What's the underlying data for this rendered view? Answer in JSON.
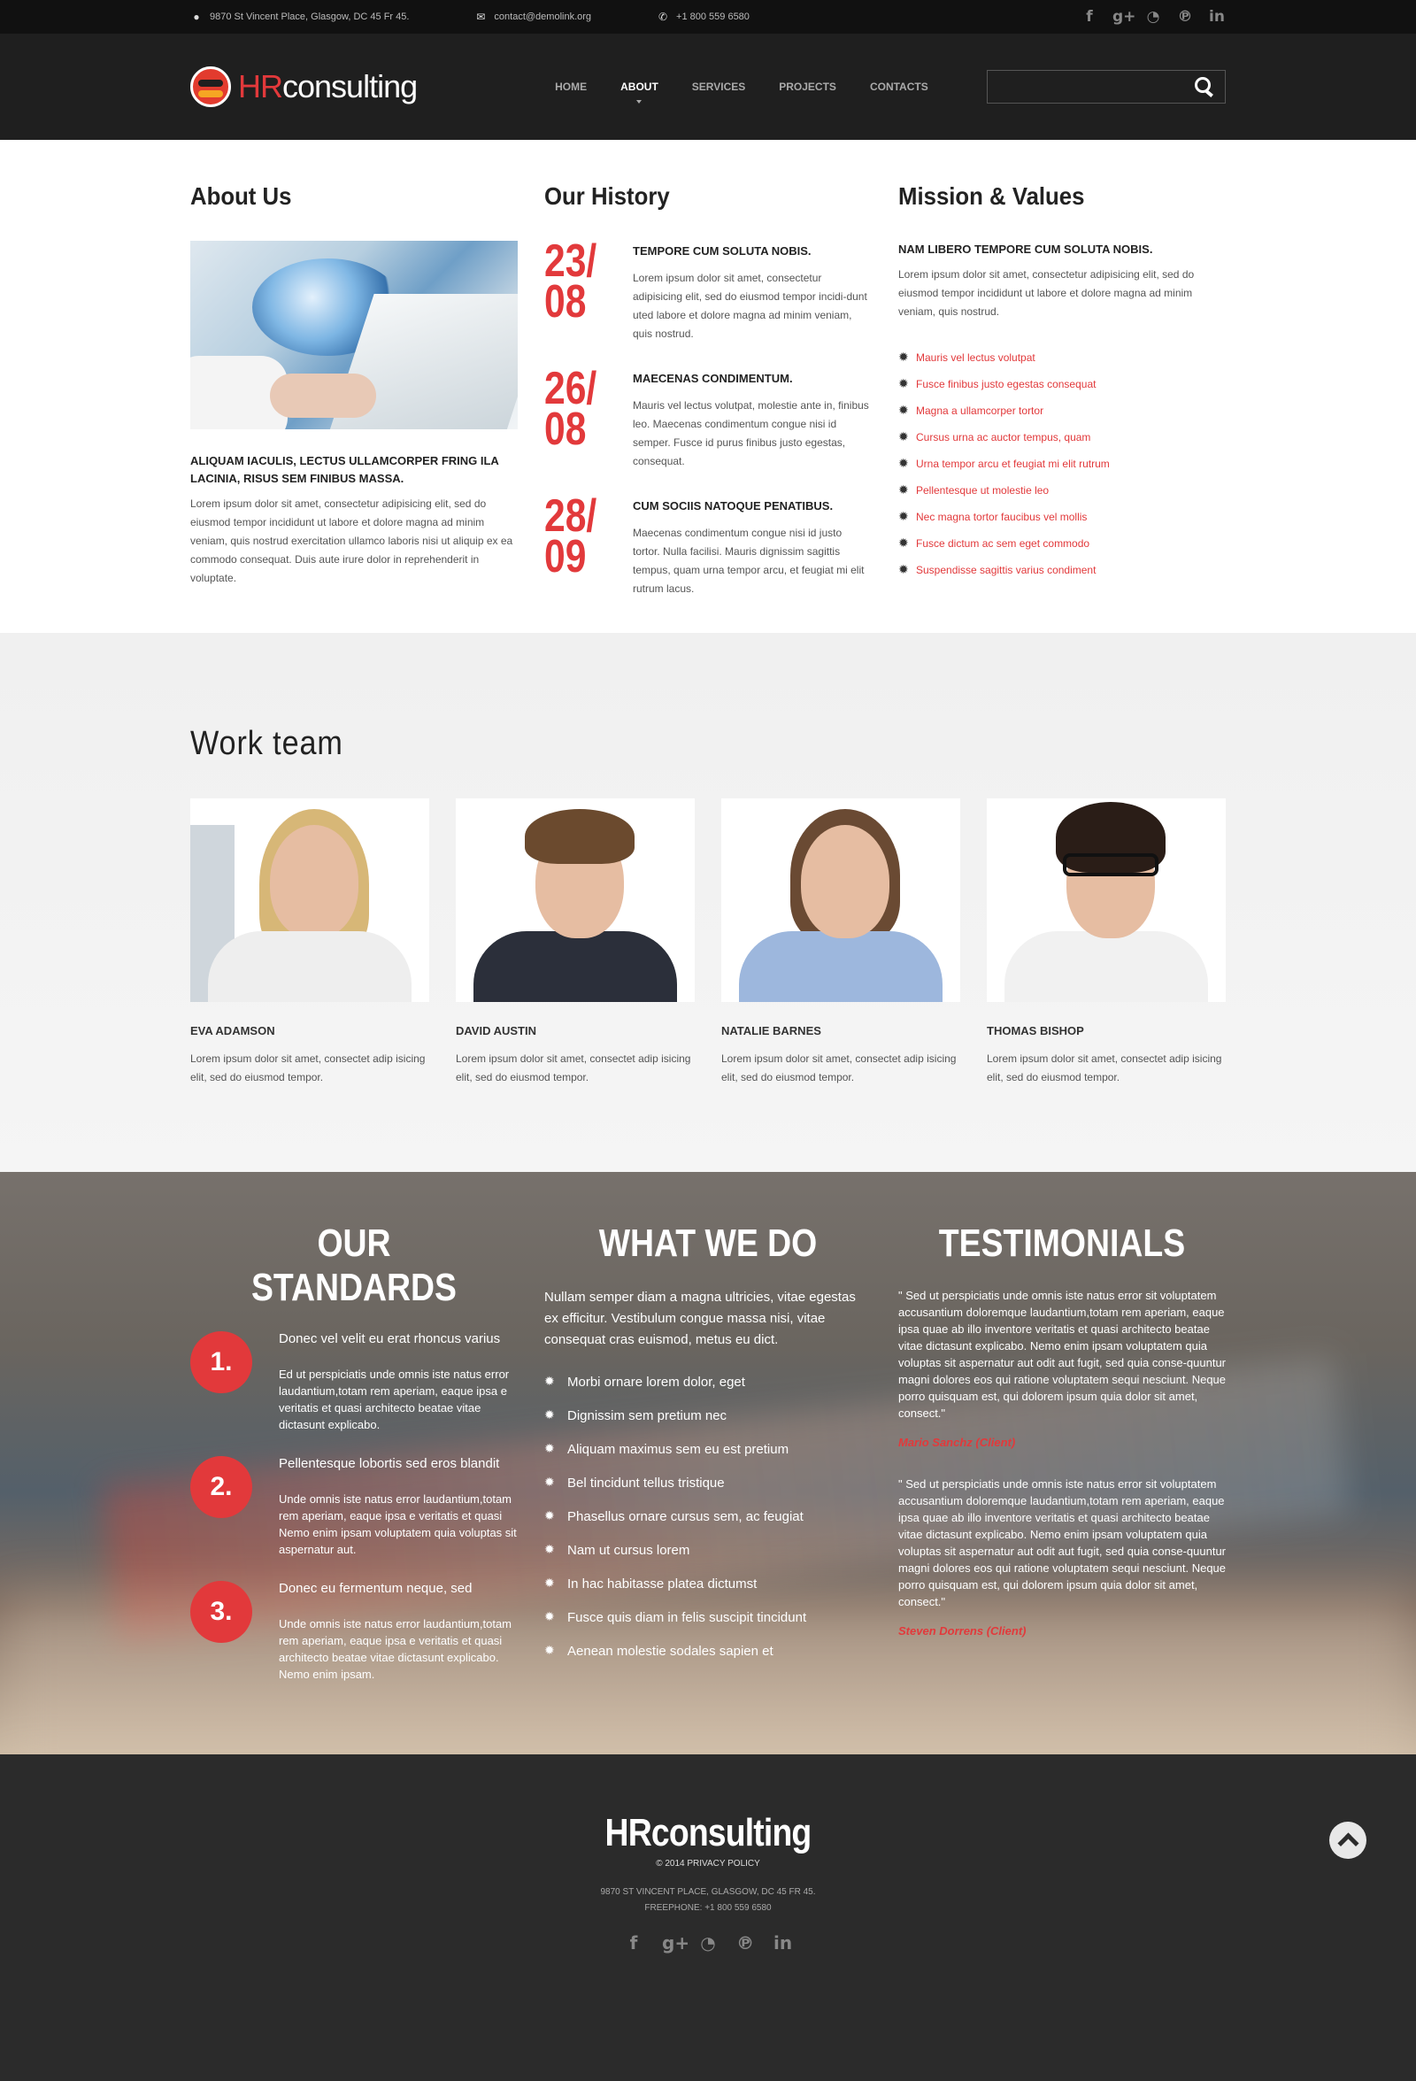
{
  "topbar": {
    "address": "9870 St Vincent Place, Glasgow, DC 45 Fr 45.",
    "email": "contact@demolink.org",
    "phone": "+1 800 559 6580",
    "social": [
      "f",
      "g+",
      "rss",
      "p",
      "in"
    ]
  },
  "header": {
    "logo_hr": "HR",
    "logo_rest": "consulting",
    "nav": [
      "HOME",
      "ABOUT",
      "SERVICES",
      "PROJECTS",
      "CONTACTS"
    ],
    "active_nav": "ABOUT",
    "search_placeholder": ""
  },
  "about": {
    "title": "About Us",
    "heading": "ALIQUAM IACULIS, LECTUS ULLAMCORPER FRING ILA LACINIA, RISUS SEM FINIBUS MASSA.",
    "text": "Lorem ipsum dolor sit amet, consectetur adipisicing elit, sed do eiusmod tempor incididunt ut labore et dolore magna ad minim veniam, quis nostrud exercitation ullamco laboris nisi ut aliquip ex ea commodo consequat. Duis aute irure dolor in reprehenderit in voluptate."
  },
  "history": {
    "title": "Our History",
    "items": [
      {
        "date1": "23/",
        "date2": "08",
        "heading": "TEMPORE CUM SOLUTA NOBIS.",
        "text": "Lorem ipsum dolor sit amet, consectetur adipisicing elit, sed do eiusmod tempor incidi-dunt uted labore et dolore magna ad minim veniam, quis nostrud."
      },
      {
        "date1": "26/",
        "date2": "08",
        "heading": "MAECENAS CONDIMENTUM.",
        "text": "Mauris vel lectus volutpat, molestie ante in, finibus leo. Maecenas condimentum congue nisi id semper. Fusce id purus finibus justo egestas, consequat."
      },
      {
        "date1": "28/",
        "date2": "09",
        "heading": "CUM SOCIIS NATOQUE PENATIBUS.",
        "text": "Maecenas condimentum congue nisi id justo tortor. Nulla facilisi. Mauris dignissim sagittis tempus, quam urna tempor arcu, et feugiat mi elit rutrum lacus."
      }
    ]
  },
  "mission": {
    "title": "Mission & Values",
    "heading": "NAM LIBERO TEMPORE CUM SOLUTA NOBIS.",
    "text": "Lorem ipsum dolor sit amet, consectetur adipisicing elit, sed do eiusmod tempor incididunt ut labore et dolore magna ad minim veniam, quis nostrud.",
    "links": [
      "Mauris vel lectus volutpat",
      "Fusce finibus justo egestas consequat",
      "Magna a ullamcorper tortor",
      "Cursus urna ac auctor tempus, quam",
      "Urna tempor arcu et feugiat mi elit rutrum",
      "Pellentesque ut molestie leo",
      "Nec magna tortor faucibus vel mollis",
      "Fusce dictum ac sem eget commodo",
      "Suspendisse sagittis varius condiment"
    ]
  },
  "team": {
    "title": "Work team",
    "members": [
      {
        "name": "EVA ADAMSON",
        "desc": "Lorem ipsum dolor sit amet, consectet adip isicing elit, sed do eiusmod tempor."
      },
      {
        "name": "DAVID AUSTIN",
        "desc": "Lorem ipsum dolor sit amet, consectet adip isicing elit, sed do eiusmod tempor."
      },
      {
        "name": "NATALIE BARNES",
        "desc": "Lorem ipsum dolor sit amet, consectet adip isicing elit, sed do eiusmod tempor."
      },
      {
        "name": "THOMAS BISHOP",
        "desc": "Lorem ipsum dolor sit amet, consectet adip isicing elit, sed do eiusmod tempor."
      }
    ]
  },
  "standards": {
    "title": "OUR STANDARDS",
    "items": [
      {
        "num": "1.",
        "title": "Donec vel velit eu erat rhoncus varius",
        "text": "Ed ut perspiciatis unde omnis iste natus error laudantium,totam rem aperiam, eaque ipsa e veritatis et quasi architecto beatae vitae dictasunt explicabo."
      },
      {
        "num": "2.",
        "title": "Pellentesque lobortis sed eros blandit",
        "text": "Unde omnis iste natus error laudantium,totam rem aperiam, eaque ipsa e veritatis et quasi Nemo enim ipsam voluptatem quia voluptas sit aspernatur aut."
      },
      {
        "num": "3.",
        "title": "Donec eu fermentum neque, sed",
        "text": "Unde omnis iste natus error laudantium,totam rem aperiam, eaque ipsa e veritatis et quasi architecto beatae vitae dictasunt explicabo. Nemo enim ipsam."
      }
    ]
  },
  "whatwedo": {
    "title": "WHAT WE DO",
    "intro": "Nullam semper diam a magna ultricies, vitae egestas ex efficitur. Vestibulum congue massa nisi, vitae consequat cras euismod, metus eu dict.",
    "items": [
      "Morbi ornare lorem dolor, eget",
      "Dignissim sem pretium nec",
      "Aliquam maximus sem eu est pretium",
      "Bel tincidunt tellus tristique",
      "Phasellus ornare cursus sem, ac feugiat",
      "Nam ut cursus lorem",
      "In hac habitasse platea dictumst",
      "Fusce quis diam in felis suscipit tincidunt",
      "Aenean molestie sodales sapien et"
    ]
  },
  "testimonials": {
    "title": "TESTIMONIALS",
    "items": [
      {
        "text": "\" Sed ut perspiciatis unde omnis iste natus error sit voluptatem accusantium doloremque laudantium,totam rem aperiam, eaque ipsa quae ab illo inventore veritatis et quasi architecto beatae vitae dictasunt explicabo. Nemo enim ipsam voluptatem quia voluptas sit aspernatur aut odit aut fugit, sed quia conse-quuntur magni dolores eos qui ratione voluptatem sequi nesciunt. Neque porro quisquam est, qui dolorem ipsum quia dolor sit amet, consect.\"",
        "author": "Mario Sanchz (Client)"
      },
      {
        "text": "\" Sed ut perspiciatis unde omnis iste natus error sit voluptatem accusantium doloremque laudantium,totam rem aperiam, eaque ipsa quae ab illo inventore veritatis et quasi architecto beatae vitae dictasunt explicabo. Nemo enim ipsam voluptatem quia voluptas sit aspernatur aut odit aut fugit, sed quia conse-quuntur magni dolores eos qui ratione voluptatem sequi nesciunt. Neque porro quisquam est, qui dolorem ipsum quia dolor sit amet, consect.\"",
        "author": "Steven Dorrens (Client)"
      }
    ]
  },
  "footer": {
    "logo": "HRconsulting",
    "copy": "© 2014 PRIVACY POLICY",
    "address": "9870 ST VINCENT PLACE, GLASGOW, DC 45 FR 45.",
    "phone": "FREEPHONE:  +1 800 559 6580",
    "social": [
      "f",
      "g+",
      "rss",
      "p",
      "in"
    ]
  },
  "colors": {
    "accent": "#e2393b",
    "dark": "#1f1f1f",
    "footer": "#2b2b2b"
  }
}
